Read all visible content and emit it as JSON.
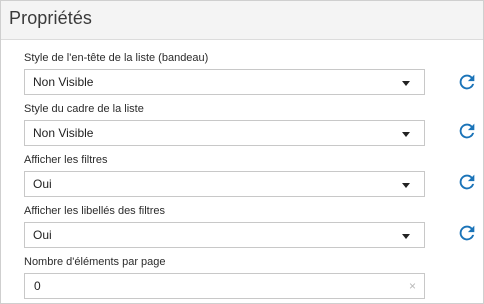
{
  "panel": {
    "title": "Propriétés"
  },
  "fields": [
    {
      "label": "Style de l'en-tête de la liste (bandeau)",
      "value": "Non Visible",
      "reset_icon": "refresh-icon"
    },
    {
      "label": "Style du cadre de la liste",
      "value": "Non Visible",
      "reset_icon": "refresh-icon"
    },
    {
      "label": "Afficher les filtres",
      "value": "Oui",
      "reset_icon": "refresh-icon"
    },
    {
      "label": "Afficher les libellés des filtres",
      "value": "Oui",
      "reset_icon": "refresh-icon"
    }
  ],
  "items_per_page": {
    "label": "Nombre d'éléments par page",
    "value": "0",
    "clear_icon": "×"
  },
  "colors": {
    "accent": "#1a73b8",
    "border": "#c8c8c8",
    "header_bg": "#f4f4f4"
  }
}
